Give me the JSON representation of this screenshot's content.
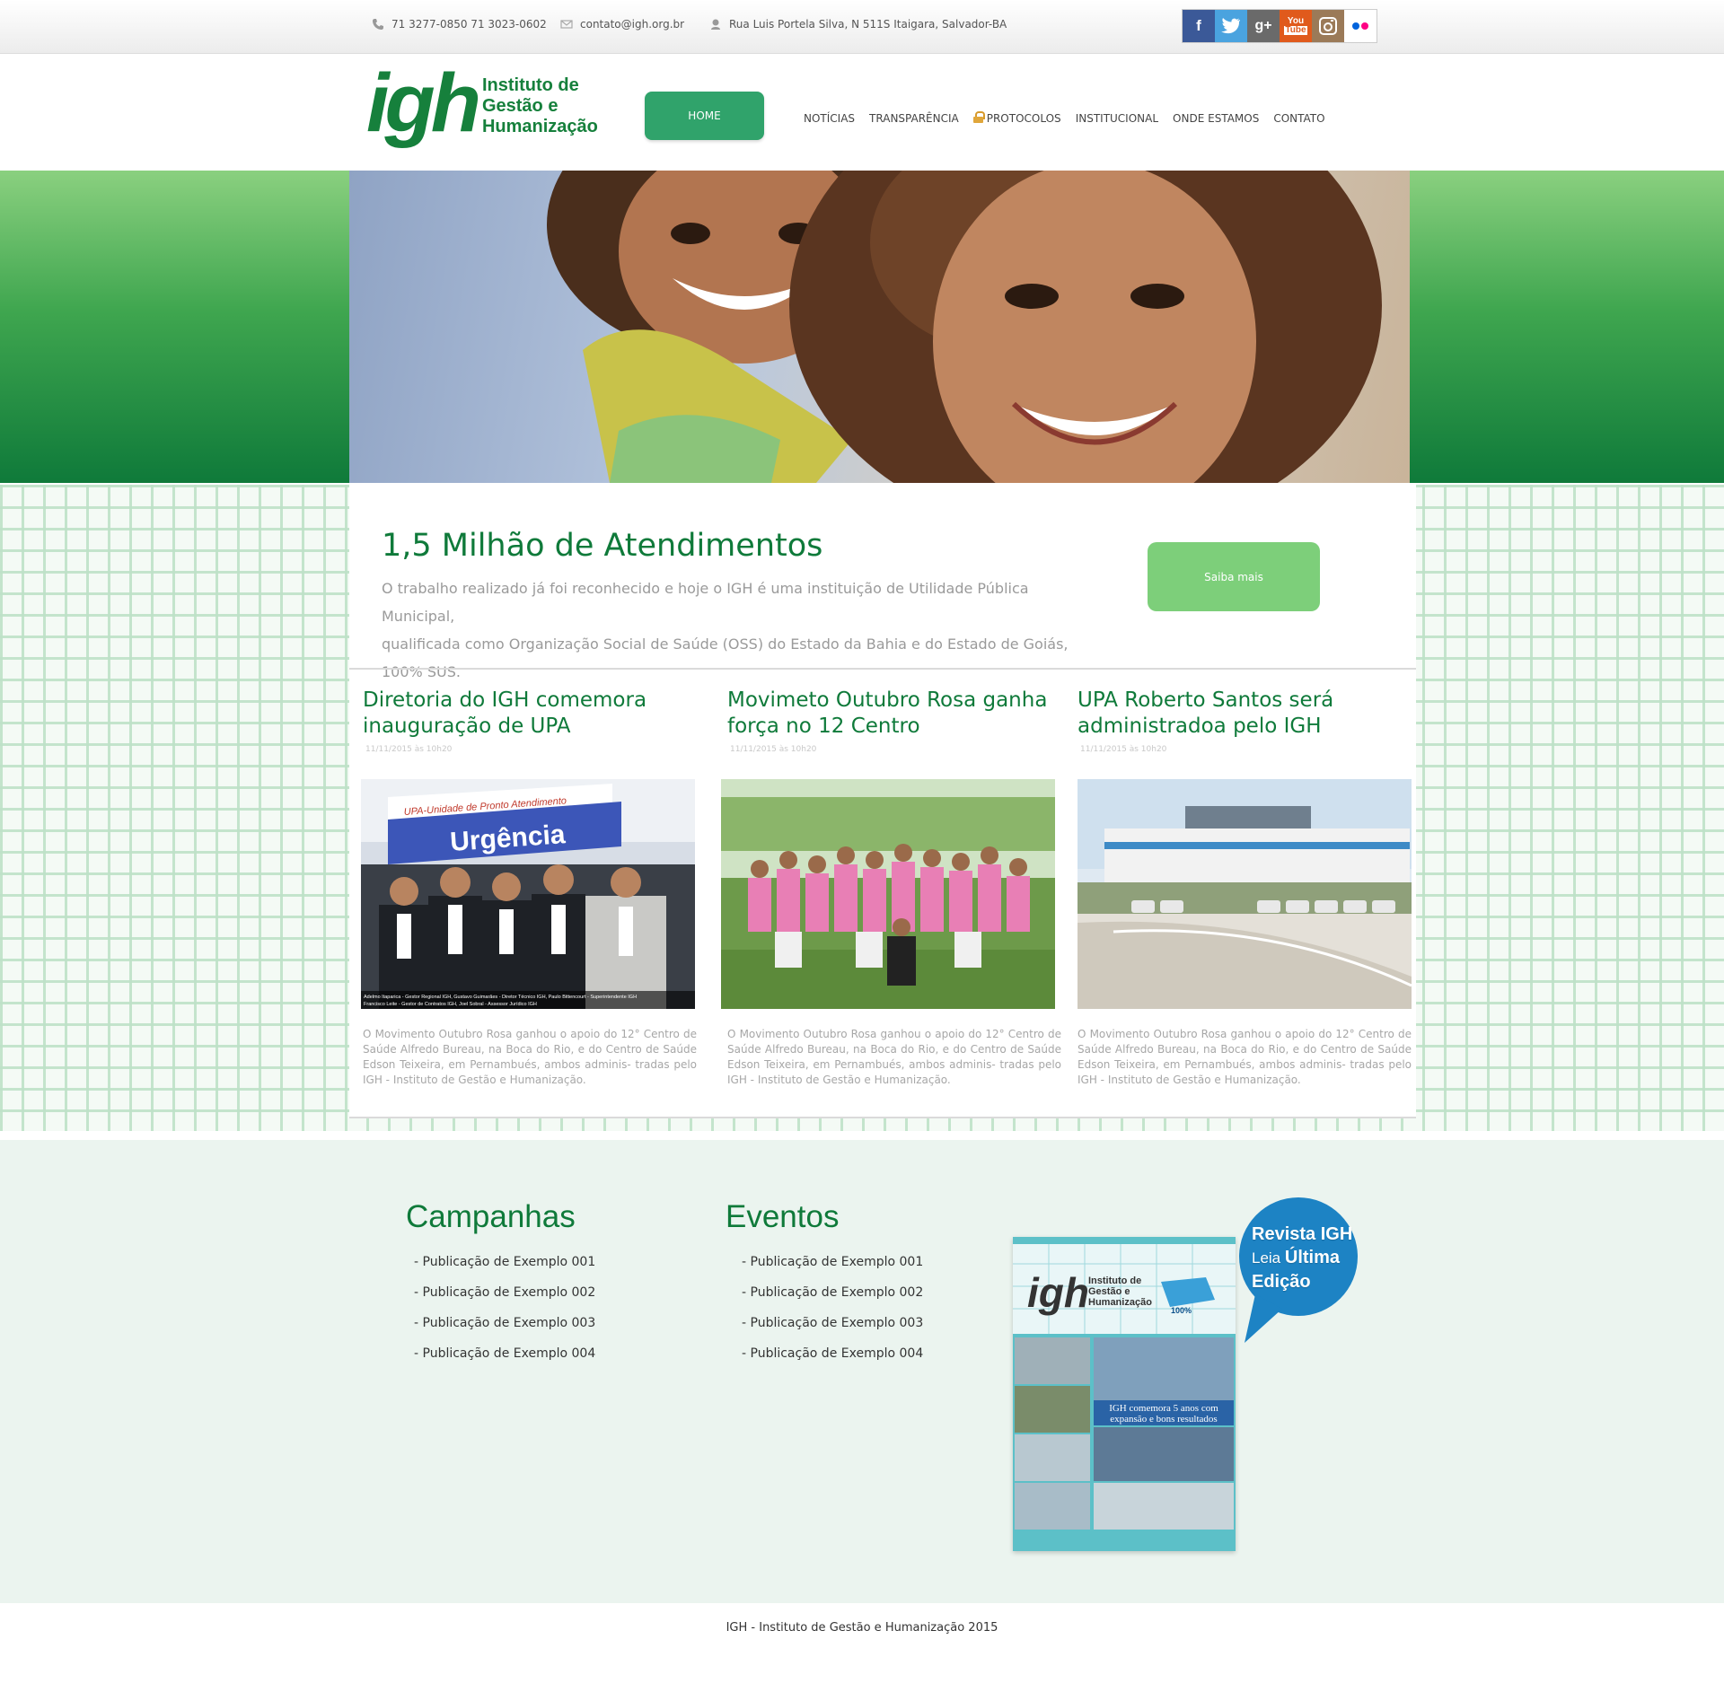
{
  "topbar": {
    "phone": "71 3277-0850  71 3023-0602",
    "email": "contato@igh.org.br",
    "address": "Rua Luis Portela Silva, N 511S  Itaigara, Salvador-BA",
    "social": [
      {
        "name": "facebook-icon",
        "glyph": "f",
        "color": "#3b5998"
      },
      {
        "name": "twitter-icon",
        "glyph": "t",
        "color": "#4aa3df"
      },
      {
        "name": "google-plus-icon",
        "glyph": "g+",
        "color": "#666666"
      },
      {
        "name": "youtube-icon",
        "glyph": "You\nTube",
        "color": "#e05a1c"
      },
      {
        "name": "instagram-icon",
        "glyph": "◎",
        "color": "#a07d5a"
      },
      {
        "name": "flickr-icon",
        "glyph": "●●",
        "color": "#ffffff"
      }
    ]
  },
  "logo": {
    "mark": "igh",
    "line1": "Instituto de",
    "line2": "Gestão e",
    "line3": "Humanização"
  },
  "nav": {
    "home": "HOME",
    "items": [
      "NOTÍCIAS",
      "TRANSPARÊNCIA",
      "PROTOCOLOS",
      "INSTITUCIONAL",
      "ONDE ESTAMOS",
      "CONTATO"
    ]
  },
  "highlight": {
    "title": "1,5 Milhão de Atendimentos",
    "line1": "O trabalho realizado já foi reconhecido e hoje o IGH é uma instituição de Utilidade Pública Municipal,",
    "line2": "qualificada como Organização Social de Saúde (OSS) do Estado da Bahia e do Estado de Goiás, 100% SUS.",
    "button": "Saiba mais"
  },
  "news": [
    {
      "title": "Diretoria do IGH comemora inauguração de UPA",
      "date": "11/11/2015 às 10h20",
      "sign_small": "UPA-Unidade de Pronto Atendimento",
      "sign_big": "Urgência",
      "caption1": "Adelmo Itaparica - Gestor Regional IGH, Gustavo Guimarães - Diretor Técnico IGH, Paulo Bittencourt - Superintendente IGH",
      "caption2": "Francisco Leite - Gestor de Contratos IGH, Joel Sobral - Assessor Jurídico IGH",
      "body": "O Movimento Outubro Rosa ganhou o apoio do 12° Centro de Saúde Alfredo Bureau, na Boca do Rio, e do Centro de Saúde Edson Teixeira, em Pernambués, ambos adminis- tradas pelo IGH - Instituto de Gestão e Humanização."
    },
    {
      "title": "Movimeto Outubro Rosa ganha força no 12 Centro",
      "date": "11/11/2015 às 10h20",
      "body": "O Movimento Outubro Rosa ganhou o apoio do 12° Centro de Saúde Alfredo Bureau, na Boca do Rio, e do Centro de Saúde Edson Teixeira, em Pernambués, ambos adminis- tradas pelo IGH - Instituto de Gestão e Humanização."
    },
    {
      "title": "UPA Roberto Santos será administradoa pelo IGH",
      "date": "11/11/2015 às 10h20",
      "body": "O Movimento Outubro Rosa ganhou o apoio do 12° Centro de Saúde Alfredo Bureau, na Boca do Rio, e do Centro de Saúde Edson Teixeira, em Pernambués, ambos adminis- tradas pelo IGH - Instituto de Gestão e Humanização."
    }
  ],
  "campanhas": {
    "title": "Campanhas",
    "items": [
      "- Publicação de Exemplo 001",
      "- Publicação de Exemplo 002",
      "- Publicação de Exemplo 003",
      "- Publicação de Exemplo 004"
    ]
  },
  "eventos": {
    "title": "Eventos",
    "items": [
      "- Publicação de Exemplo 001",
      "- Publicação de Exemplo 002",
      "- Publicação de Exemplo 003",
      "- Publicação de Exemplo 004"
    ]
  },
  "revista": {
    "bubble1": "Revista IGH",
    "bubble2a": "Leia ",
    "bubble2b": "Última",
    "bubble3": "Edição",
    "cover_mark": "igh",
    "cover_l1": "Instituto de",
    "cover_l2": "Gestão e",
    "cover_l3": "Humanização",
    "cover_badge": "100%",
    "cover_headline1": "IGH comemora 5 anos com",
    "cover_headline2": "expansão e bons resultados"
  },
  "footer": {
    "text": "IGH - Instituto de Gestão e Humanização 2015"
  }
}
